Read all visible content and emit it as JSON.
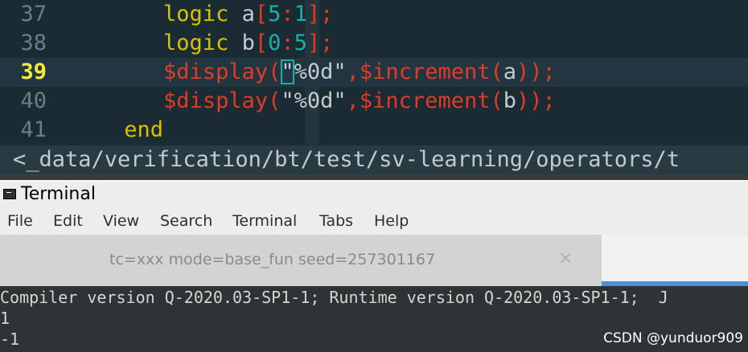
{
  "editor": {
    "lines": [
      {
        "number": "37",
        "tokens": [
          {
            "t": "        ",
            "c": ""
          },
          {
            "t": "logic",
            "c": "kw"
          },
          {
            "t": " a",
            "c": ""
          },
          {
            "t": "[",
            "c": "punc"
          },
          {
            "t": "5",
            "c": "num"
          },
          {
            "t": ":",
            "c": "punc"
          },
          {
            "t": "1",
            "c": "num"
          },
          {
            "t": "];",
            "c": "punc"
          }
        ]
      },
      {
        "number": "38",
        "tokens": [
          {
            "t": "        ",
            "c": ""
          },
          {
            "t": "logic",
            "c": "kw"
          },
          {
            "t": " b",
            "c": ""
          },
          {
            "t": "[",
            "c": "punc"
          },
          {
            "t": "0",
            "c": "num"
          },
          {
            "t": ":",
            "c": "punc"
          },
          {
            "t": "5",
            "c": "num"
          },
          {
            "t": "];",
            "c": "punc"
          }
        ]
      },
      {
        "number": "39",
        "current": true,
        "tokens": [
          {
            "t": "        ",
            "c": ""
          },
          {
            "t": "$display",
            "c": "sys"
          },
          {
            "t": "(",
            "c": "punc"
          },
          {
            "t": "\"",
            "c": "str cursor-ch"
          },
          {
            "t": "%0d\"",
            "c": "str"
          },
          {
            "t": ",",
            "c": "punc"
          },
          {
            "t": "$increment",
            "c": "sys"
          },
          {
            "t": "(",
            "c": "punc"
          },
          {
            "t": "a",
            "c": ""
          },
          {
            "t": "));",
            "c": "punc"
          }
        ]
      },
      {
        "number": "40",
        "tokens": [
          {
            "t": "        ",
            "c": ""
          },
          {
            "t": "$display",
            "c": "sys"
          },
          {
            "t": "(",
            "c": "punc"
          },
          {
            "t": "\"%0d\"",
            "c": "str"
          },
          {
            "t": ",",
            "c": "punc"
          },
          {
            "t": "$increment",
            "c": "sys"
          },
          {
            "t": "(",
            "c": "punc"
          },
          {
            "t": "b",
            "c": ""
          },
          {
            "t": "));",
            "c": "punc"
          }
        ]
      },
      {
        "number": "41",
        "tokens": [
          {
            "t": "     ",
            "c": ""
          },
          {
            "t": "end",
            "c": "kw"
          }
        ]
      }
    ],
    "status_path": "<_data/verification/bt/test/sv-learning/operators/t"
  },
  "terminal": {
    "title": "Terminal",
    "menu": [
      "File",
      "Edit",
      "View",
      "Search",
      "Terminal",
      "Tabs",
      "Help"
    ],
    "tab_label": "tc=xxx  mode=base_fun  seed=257301167",
    "tab_close": "×",
    "output": [
      "Compiler version Q-2020.03-SP1-1; Runtime version Q-2020.03-SP1-1;  J",
      "1",
      "-1"
    ],
    "watermark": "CSDN @yunduor909"
  },
  "colors": {
    "editor_bg": "#1a2b33",
    "keyword": "#d9c100",
    "system_task": "#e23b24",
    "number": "#16b1a8",
    "current_line_number": "#f6ea3a",
    "tab_indicator": "#4a90d9"
  }
}
